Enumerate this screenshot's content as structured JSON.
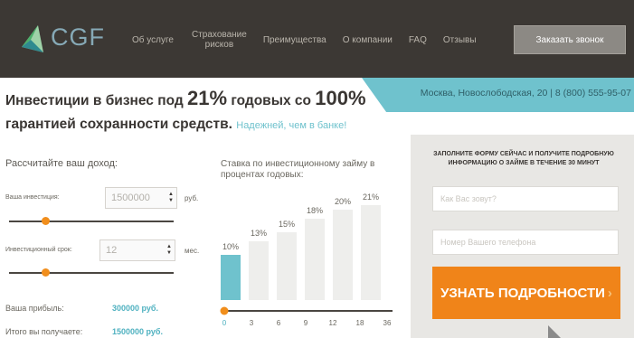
{
  "header": {
    "logo_text": "CGF",
    "nav": [
      {
        "label": "Об услуге"
      },
      {
        "label": "Страхование\nрисков"
      },
      {
        "label": "Преимущества"
      },
      {
        "label": "О компании"
      },
      {
        "label": "FAQ"
      },
      {
        "label": "Отзывы"
      }
    ],
    "order_button": "Заказать звонок"
  },
  "contact": {
    "text": "Москва, Новослободская, 20 | 8 (800) 555-95-07"
  },
  "headline": {
    "part1": "Инвестиции в бизнес под ",
    "rate": "21%",
    "part2": " годовых со ",
    "guarantee": "100%",
    "part3": "гарантией сохранности средств.",
    "tagline": "Надежней, чем в банке!"
  },
  "calculator": {
    "title": "Рассчитайте ваш доход:",
    "investment": {
      "label": "Ваша инвестиция:",
      "value": "1500000",
      "unit": "руб.",
      "slider_fraction": 0.22
    },
    "term": {
      "label": "Инвестиционный срок:",
      "value": "12",
      "unit": "мес.",
      "slider_fraction": 0.22
    },
    "profit": {
      "label": "Ваша прибыль:",
      "value": "300000 руб."
    },
    "total": {
      "label": "Итого вы получаете:",
      "value": "1500000 руб."
    }
  },
  "chart_title": "Ставка по инвестиционному займу в процентах годовых:",
  "chart_data": {
    "type": "bar",
    "categories": [
      "0",
      "3",
      "6",
      "9",
      "12",
      "18",
      "36"
    ],
    "bars": [
      {
        "label": "10%",
        "value": 10
      },
      {
        "label": "13%",
        "value": 13
      },
      {
        "label": "15%",
        "value": 15
      },
      {
        "label": "18%",
        "value": 18
      },
      {
        "label": "20%",
        "value": 20
      },
      {
        "label": "21%",
        "value": 21
      }
    ],
    "highlighted_index": 0,
    "colors": {
      "highlight": "#6fc2cd",
      "bar": "#eeeeec",
      "track": "#4a4641",
      "knob": "#f18e1c"
    }
  },
  "form": {
    "title": "ЗАПОЛНИТЕ ФОРМУ СЕЙЧАС И ПОЛУЧИТЕ ПОДРОБНУЮ ИНФОРМАЦИЮ О ЗАЙМЕ В ТЕЧЕНИЕ 30 МИНУТ",
    "name_placeholder": "Как Вас зовут?",
    "phone_placeholder": "Номер Вашего телефона",
    "submit": "УЗНАТЬ ПОДРОБНОСТИ",
    "submit_arrow": "›"
  },
  "colors": {
    "header_bg": "#3c3834",
    "accent": "#6fc2cd",
    "cta": "#f08419"
  }
}
